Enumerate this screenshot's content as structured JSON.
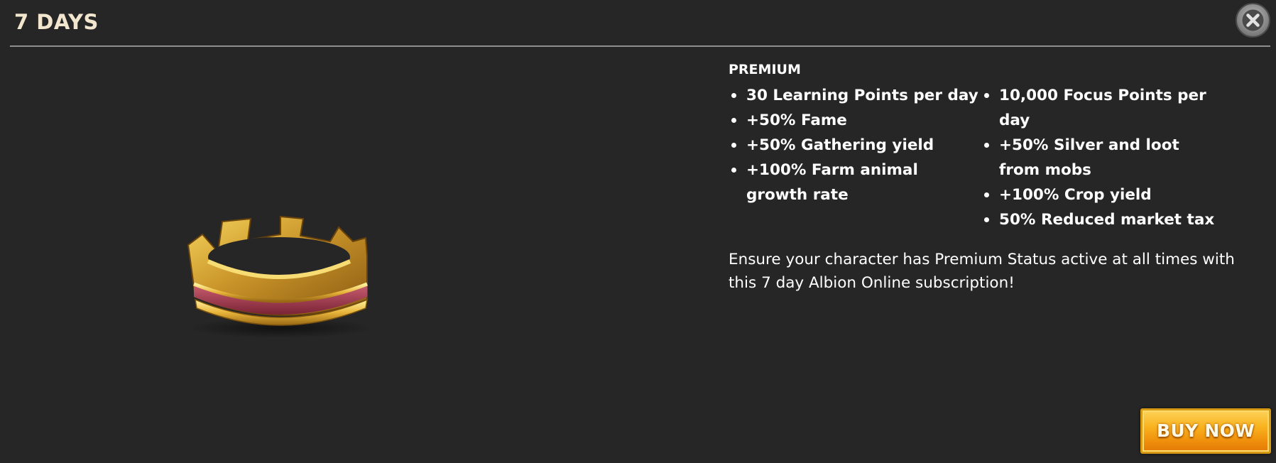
{
  "header": {
    "title": "7 DAYS",
    "close_icon": "close-x-circle-icon"
  },
  "product_image": {
    "icon": "crown-icon"
  },
  "premium": {
    "section_title": "PREMIUM",
    "benefits_left": [
      "30 Learning Points per day",
      "+50% Fame",
      "+50% Gathering yield",
      "+100% Farm animal growth rate"
    ],
    "benefits_right": [
      "10,000 Focus Points per day",
      "+50% Silver and loot from mobs",
      "+100% Crop yield",
      "50% Reduced market tax"
    ],
    "description": "Ensure your character has Premium Status active at all times with this 7 day Albion Online subscription!"
  },
  "buy_button": {
    "label": "BUY NOW"
  },
  "colors": {
    "background": "#262626",
    "title": "#f3e6cf",
    "button": "#f5a516"
  }
}
